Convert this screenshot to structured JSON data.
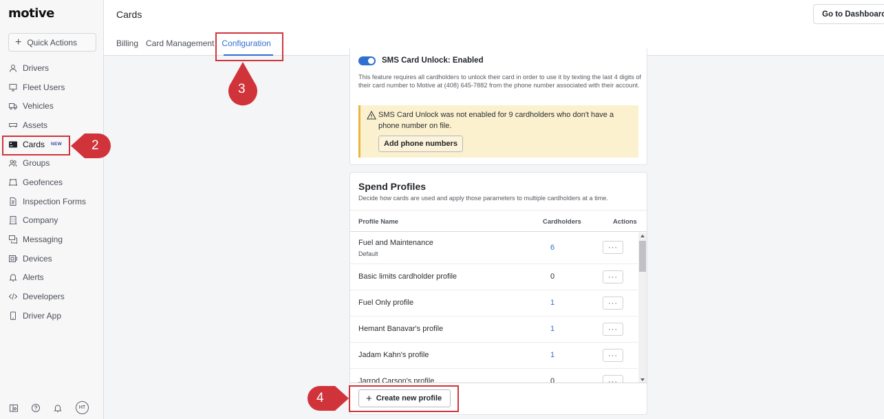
{
  "brand": {
    "logo": "motive"
  },
  "sidebar": {
    "quick_actions_label": "Quick Actions",
    "items": [
      {
        "label": "Drivers",
        "icon": "person-icon"
      },
      {
        "label": "Fleet Users",
        "icon": "monitor-icon"
      },
      {
        "label": "Vehicles",
        "icon": "truck-icon"
      },
      {
        "label": "Assets",
        "icon": "trailer-icon"
      },
      {
        "label": "Cards",
        "icon": "card-icon",
        "badge": "NEW",
        "active": true
      },
      {
        "label": "Groups",
        "icon": "group-icon"
      },
      {
        "label": "Geofences",
        "icon": "geofence-icon"
      },
      {
        "label": "Inspection Forms",
        "icon": "document-icon"
      },
      {
        "label": "Company",
        "icon": "building-icon"
      },
      {
        "label": "Messaging",
        "icon": "chat-icon"
      },
      {
        "label": "Devices",
        "icon": "device-icon"
      },
      {
        "label": "Alerts",
        "icon": "bell-icon"
      },
      {
        "label": "Developers",
        "icon": "code-icon"
      },
      {
        "label": "Driver App",
        "icon": "phone-icon"
      }
    ],
    "user_initials": "HT"
  },
  "header": {
    "title": "Cards",
    "dashboard_button": "Go to Dashboard",
    "tabs": [
      {
        "label": "Billing"
      },
      {
        "label": "Card Management"
      },
      {
        "label": "Configuration",
        "active": true
      }
    ]
  },
  "sms": {
    "title": "SMS Card Unlock: Enabled",
    "enabled": true,
    "description": "This feature requires all cardholders to unlock their card in order to use it by texting the last 4 digits of their card number to Motive at (408) 645-7882 from the phone number associated with their account.",
    "warning_text": "SMS Card Unlock was not enabled for 9 cardholders who don't have a phone number on file.",
    "warning_button": "Add phone numbers"
  },
  "spend_profiles": {
    "title": "Spend Profiles",
    "subtitle": "Decide how cards are used and apply those parameters to multiple cardholders at a time.",
    "columns": {
      "name": "Profile Name",
      "cardholders": "Cardholders",
      "actions": "Actions"
    },
    "rows": [
      {
        "name": "Fuel and Maintenance",
        "sub": "Default",
        "cardholders": "6",
        "link": true
      },
      {
        "name": "Basic limits cardholder profile",
        "cardholders": "0",
        "link": false
      },
      {
        "name": "Fuel Only profile",
        "cardholders": "1",
        "link": true
      },
      {
        "name": "Hemant Banavar's profile",
        "cardholders": "1",
        "link": true
      },
      {
        "name": "Jadam Kahn's profile",
        "cardholders": "1",
        "link": true
      },
      {
        "name": "Jarrod Carson's profile",
        "cardholders": "0",
        "link": false
      }
    ],
    "more_label": "···",
    "create_button": "Create new profile"
  },
  "annotations": {
    "step2": "2",
    "step3": "3",
    "step4": "4",
    "color": "#d0343a"
  }
}
